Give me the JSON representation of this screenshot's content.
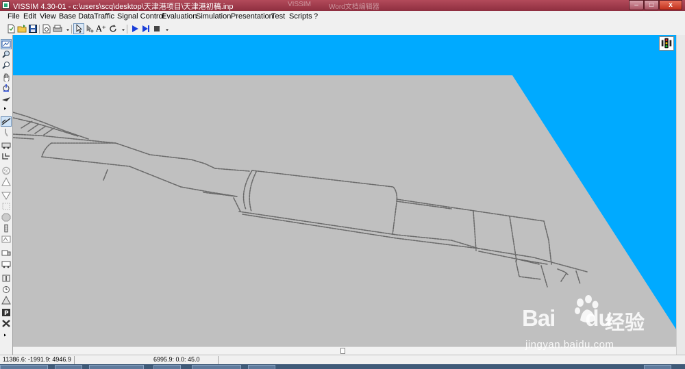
{
  "window": {
    "title": "VISSIM 4.30-01 - c:\\users\\scq\\desktop\\天津港项目\\天津港初稿.inp",
    "background_tabs": [
      "VISSIM",
      "Word文档编辑器"
    ],
    "controls": {
      "minimize": "–",
      "maximize": "□",
      "close": "x"
    }
  },
  "menu": [
    {
      "id": "file",
      "label": "File"
    },
    {
      "id": "edit",
      "label": "Edit"
    },
    {
      "id": "view",
      "label": "View"
    },
    {
      "id": "base-data",
      "label": "Base Data"
    },
    {
      "id": "traffic",
      "label": "Traffic"
    },
    {
      "id": "signal-control",
      "label": "Signal Control"
    },
    {
      "id": "evaluation",
      "label": "Evaluation"
    },
    {
      "id": "simulation",
      "label": "Simulation"
    },
    {
      "id": "presentation",
      "label": "Presentation"
    },
    {
      "id": "test",
      "label": "Test"
    },
    {
      "id": "scripts",
      "label": "Scripts"
    },
    {
      "id": "help",
      "label": "?"
    }
  ],
  "toolbar": {
    "text_tool_label": "A⁺"
  },
  "status": {
    "coordinates": "11386.6: -1991.9: 4946.9",
    "view_angles": "6995.9: 0.0: 45.0"
  },
  "watermark": {
    "logo": "Bai",
    "logo_suffix": "du",
    "brand_cn": "经验",
    "url": "jingyan.baidu.com"
  },
  "colors": {
    "sky": "#00aaff",
    "ground": "#c0c0c0",
    "links": "#6a6a6a",
    "titlebar": "#9e3a4c"
  }
}
